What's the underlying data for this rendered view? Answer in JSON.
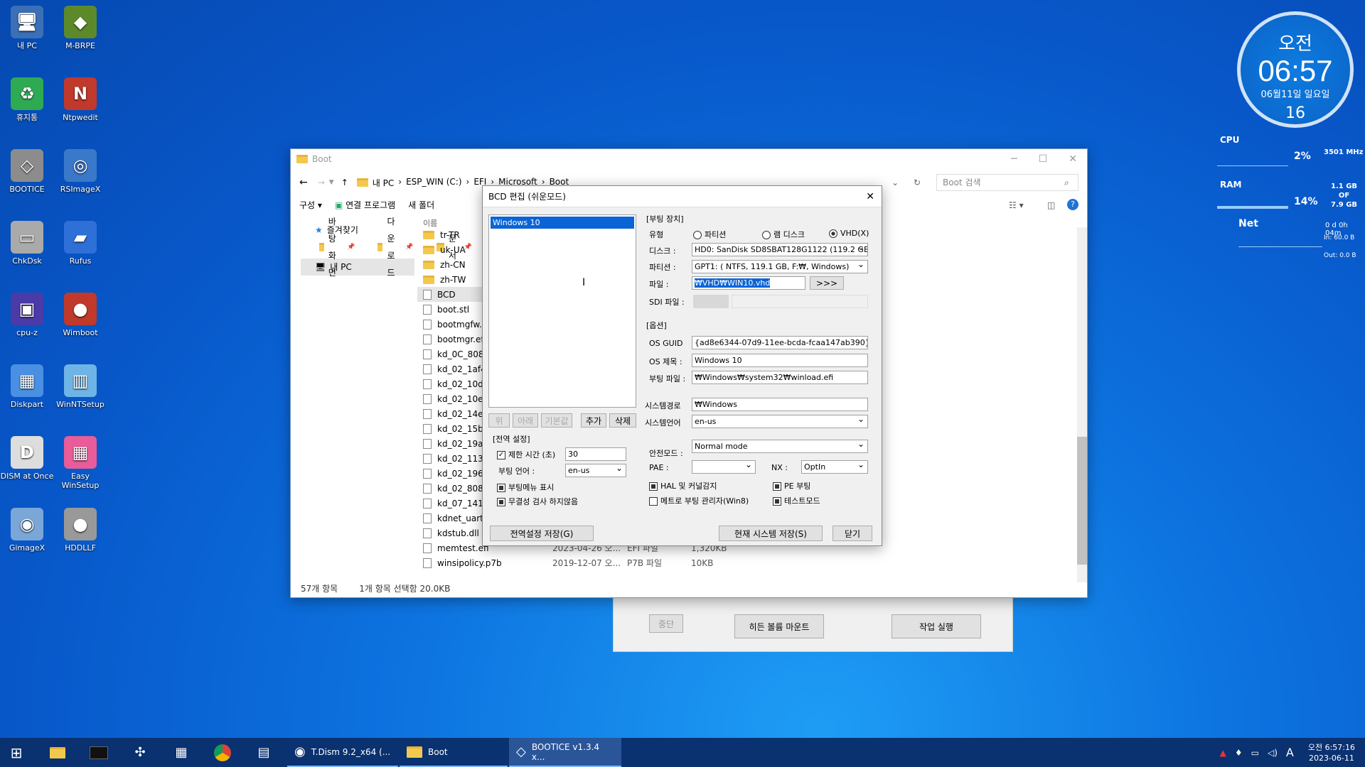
{
  "desktop_icons": [
    {
      "label": "내 PC",
      "icon": "pc-icon"
    },
    {
      "label": "M-BRPE",
      "icon": "drive-icon"
    },
    {
      "label": "휴지통",
      "icon": "recycle-bin-icon"
    },
    {
      "label": "Ntpwedit",
      "icon": "ntpwedit-icon"
    },
    {
      "label": "BOOTICE",
      "icon": "bootice-icon"
    },
    {
      "label": "RSImageX",
      "icon": "rsimagex-icon"
    },
    {
      "label": "ChkDsk",
      "icon": "chkdsk-icon"
    },
    {
      "label": "Rufus",
      "icon": "rufus-icon"
    },
    {
      "label": "cpu-z",
      "icon": "cpuz-icon"
    },
    {
      "label": "Wimboot",
      "icon": "wimboot-icon"
    },
    {
      "label": "Diskpart",
      "icon": "diskpart-icon"
    },
    {
      "label": "WinNTSetup",
      "icon": "winntsetup-icon"
    },
    {
      "label": "DISM at Once",
      "icon": "dism-icon"
    },
    {
      "label": "Easy WinSetup",
      "icon": "easywinsetup-icon"
    },
    {
      "label": "GimageX",
      "icon": "gimagex-icon"
    },
    {
      "label": "HDDLLF",
      "icon": "hddllf-icon"
    }
  ],
  "clock": {
    "ampm": "오전",
    "time": "06:57",
    "date": "06월11일 일요일",
    "seconds": "16"
  },
  "sysmon": {
    "cpu_label": "CPU",
    "cpu_pct": "2%",
    "cpu_freq": "3501 MHz",
    "ram_label": "RAM",
    "ram_pct": "14%",
    "ram_used": "1.1 GB",
    "ram_of": "OF",
    "ram_total": "7.9 GB",
    "net_label": "Net",
    "uptime": "0 d 0h 04m",
    "net_in": "In: 60.0 B",
    "net_out": "Out: 0.0 B"
  },
  "explorer": {
    "title": "Boot",
    "breadcrumb": [
      "내 PC",
      "ESP_WIN (C:)",
      "EFI",
      "Microsoft",
      "Boot"
    ],
    "search_placeholder": "Boot 검색",
    "toolbar": {
      "organize": "구성",
      "open_with": "연결 프로그램",
      "new_folder": "새 폴더"
    },
    "nav": {
      "favorites": "즐겨찾기",
      "items": [
        "바탕 화면",
        "다운로드",
        "문서",
        "그림"
      ],
      "this_pc": "내 PC"
    },
    "column_name": "이름",
    "files": [
      {
        "name": "tr-TR",
        "kind": "folder"
      },
      {
        "name": "uk-UA",
        "kind": "folder"
      },
      {
        "name": "zh-CN",
        "kind": "folder"
      },
      {
        "name": "zh-TW",
        "kind": "folder"
      },
      {
        "name": "BCD",
        "kind": "file"
      },
      {
        "name": "boot.stl",
        "kind": "file"
      },
      {
        "name": "bootmgfw.efi",
        "kind": "file"
      },
      {
        "name": "bootmgr.efi",
        "kind": "file"
      },
      {
        "name": "kd_0C_8086.c",
        "kind": "file"
      },
      {
        "name": "kd_02_1af4.dl",
        "kind": "file"
      },
      {
        "name": "kd_02_10df.d",
        "kind": "file"
      },
      {
        "name": "kd_02_10ec.d",
        "kind": "file"
      },
      {
        "name": "kd_02_14e4.d",
        "kind": "file"
      },
      {
        "name": "kd_02_15b3.c",
        "kind": "file"
      },
      {
        "name": "kd_02_19a2.d",
        "kind": "file"
      },
      {
        "name": "kd_02_1137.c",
        "kind": "file"
      },
      {
        "name": "kd_02_1969.c",
        "kind": "file"
      },
      {
        "name": "kd_02_8086.c",
        "kind": "file"
      },
      {
        "name": "kd_07_1415.c",
        "kind": "file"
      },
      {
        "name": "kdnet_uart165",
        "kind": "file"
      },
      {
        "name": "kdstub.dll",
        "kind": "file"
      },
      {
        "name": "memtest.efi",
        "kind": "file",
        "date": "2023-04-26 오...",
        "type": "EFI 파일",
        "size": "1,320KB"
      },
      {
        "name": "winsipolicy.p7b",
        "kind": "file",
        "date": "2019-12-07 오...",
        "type": "P7B 파일",
        "size": "10KB"
      }
    ],
    "status_count": "57개 항목",
    "status_selected": "1개 항목 선택함 20.0KB"
  },
  "tdism": {
    "stop": "중단",
    "mount": "히든 볼륨 마운트",
    "run": "작업 실행"
  },
  "bcd": {
    "title": "BCD 편집 (쉬운모드)",
    "entries": [
      "Windows 10"
    ],
    "list_buttons": {
      "up": "위",
      "down": "아래",
      "default": "기본값",
      "add": "추가",
      "delete": "삭제"
    },
    "global": {
      "header": "[전역 설정]",
      "timeout_label": "제한 시간 (초)",
      "timeout": "30",
      "lang_label": "부팅 언어 :",
      "lang": "en-us",
      "show_menu": "부팅메뉴 표시",
      "no_integrity": "무결성 검사 하지않음"
    },
    "device": {
      "header": "[부팅 장치]",
      "type_label": "유형",
      "opt_partition": "파티션",
      "opt_ramdisk": "램 디스크",
      "opt_vhd": "VHD(X)",
      "disk_label": "디스크 :",
      "disk": "HD0: SanDisk SD8SBAT128G1122 (119.2 GB, C",
      "part_label": "파티션 :",
      "part": "GPT1: ( NTFS, 119.1 GB, F:₩, Windows)",
      "file_label": "파일 :",
      "file": "₩VHD₩WIN10.vhd",
      "browse": ">>>",
      "sdi_label": "SDI 파일 :"
    },
    "options": {
      "header": "[옵션]",
      "guid_label": "OS GUID",
      "guid": "{ad8e6344-07d9-11ee-bcda-fcaa147ab390}",
      "title_label": "OS 제목 :",
      "title": "Windows 10",
      "bootfile_label": "부팅 파일 :",
      "bootfile": "₩Windows₩system32₩winload.efi",
      "syspath_label": "시스템경로",
      "syspath": "₩Windows",
      "syslang_label": "시스템언어",
      "syslang": "en-us",
      "safemode_label": "안전모드 :",
      "safemode": "Normal mode",
      "pae_label": "PAE :",
      "pae": "",
      "nx_label": "NX :",
      "nx": "OptIn",
      "hal": "HAL 및 커널감지",
      "pe": "PE 부팅",
      "metro": "메트로 부팅 관리자(Win8)",
      "test": "테스트모드"
    },
    "buttons": {
      "save_global": "전역설정 저장(G)",
      "save_current": "현재 시스템 저장(S)",
      "close": "닫기"
    }
  },
  "taskbar": {
    "apps": [
      {
        "label": "T.Dism 9.2_x64  (..."
      },
      {
        "label": "Boot"
      },
      {
        "label": "BOOTICE v1.3.4 x..."
      }
    ],
    "tray_lang": "A",
    "time": "오전 6:57:16",
    "date": "2023-06-11"
  }
}
